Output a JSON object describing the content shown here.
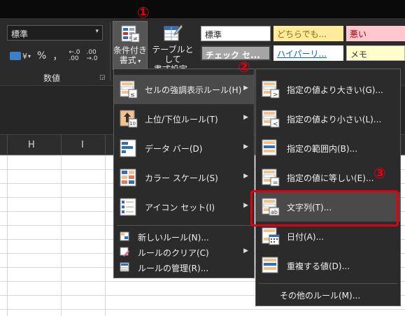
{
  "ribbon": {
    "number_format_value": "標準",
    "number_group_label": "数値",
    "currency_symbol": "¥",
    "percent_symbol": "%",
    "comma_symbol": "，",
    "conditional_format_label_1": "条件付き",
    "conditional_format_label_2": "書式",
    "format_as_table_label_1": "テーブルとして",
    "format_as_table_label_2": "書式設定"
  },
  "cell_styles": [
    "標準",
    "どちらでも...",
    "悪い",
    "チェック セ...",
    "ハイパーリ...",
    "メモ"
  ],
  "callouts": [
    "①",
    "②",
    "③"
  ],
  "columns": [
    "H",
    "I"
  ],
  "cf_menu": {
    "items": [
      {
        "label": "セルの強調表示ルール(H)",
        "submenu": true,
        "icon": "highlight-cells-rules-icon"
      },
      {
        "label": "上位/下位ルール(T)",
        "submenu": true,
        "icon": "top-bottom-rules-icon"
      },
      {
        "label": "データ バー(D)",
        "submenu": true,
        "icon": "data-bars-icon"
      },
      {
        "label": "カラー スケール(S)",
        "submenu": true,
        "icon": "color-scales-icon"
      },
      {
        "label": "アイコン セット(I)",
        "submenu": true,
        "icon": "icon-sets-icon"
      }
    ],
    "commands": [
      {
        "label": "新しいルール(N)...",
        "submenu": false,
        "icon": "new-rule-icon"
      },
      {
        "label": "ルールのクリア(C)",
        "submenu": true,
        "icon": "clear-rules-icon"
      },
      {
        "label": "ルールの管理(R)...",
        "submenu": false,
        "icon": "manage-rules-icon"
      }
    ]
  },
  "highlight_menu": {
    "items": [
      {
        "label": "指定の値より大きい(G)...",
        "icon": "greater-than-icon"
      },
      {
        "label": "指定の値より小さい(L)...",
        "icon": "less-than-icon"
      },
      {
        "label": "指定の範囲内(B)...",
        "icon": "between-icon"
      },
      {
        "label": "指定の値に等しい(E)...",
        "icon": "equal-to-icon"
      },
      {
        "label": "文字列(T)...",
        "icon": "text-contains-icon"
      },
      {
        "label": "日付(A)...",
        "icon": "date-occurring-icon"
      },
      {
        "label": "重複する値(D)...",
        "icon": "duplicate-values-icon"
      }
    ],
    "more_rules": "その他のルール(M)..."
  },
  "colors": {
    "accent_red": "#e60012",
    "menu_bg": "#2b2b2b",
    "highlight_bg": "#4a4a4a"
  }
}
